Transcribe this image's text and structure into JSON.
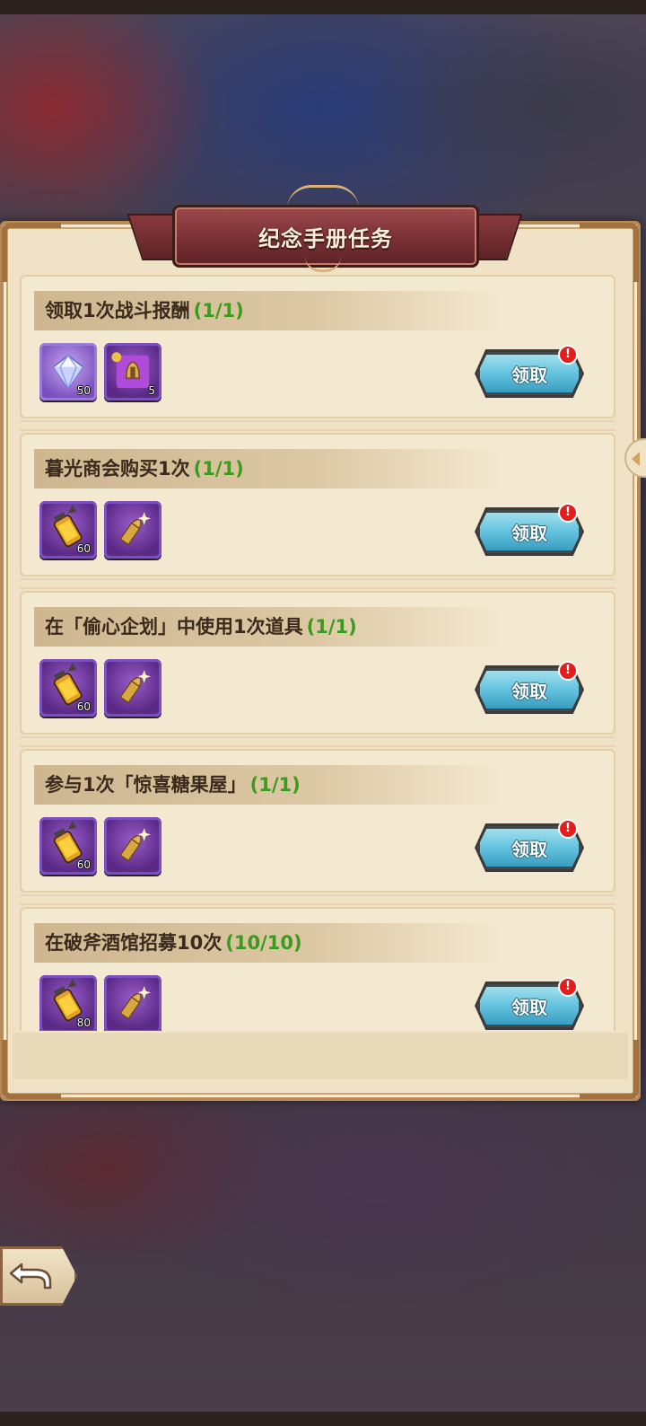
{
  "panel": {
    "title": "纪念手册任务"
  },
  "tasks": [
    {
      "title": "领取1次战斗报酬",
      "progress": "(1/1)",
      "rewards": [
        {
          "icon": "diamond-icon",
          "count": "50"
        },
        {
          "icon": "puzzle-helmet-icon",
          "count": "5"
        }
      ],
      "claim_label": "领取",
      "badge": "!"
    },
    {
      "title": "暮光商会购买1次",
      "progress": "(1/1)",
      "rewards": [
        {
          "icon": "fuel-canister-icon",
          "count": "60"
        },
        {
          "icon": "bullet-icon",
          "count": ""
        }
      ],
      "claim_label": "领取",
      "badge": "!"
    },
    {
      "title": "在「偷心企划」中使用1次道具",
      "progress": "(1/1)",
      "rewards": [
        {
          "icon": "fuel-canister-icon",
          "count": "60"
        },
        {
          "icon": "bullet-icon",
          "count": ""
        }
      ],
      "claim_label": "领取",
      "badge": "!"
    },
    {
      "title": "参与1次「惊喜糖果屋」",
      "progress": "(1/1)",
      "rewards": [
        {
          "icon": "fuel-canister-icon",
          "count": "60"
        },
        {
          "icon": "bullet-icon",
          "count": ""
        }
      ],
      "claim_label": "领取",
      "badge": "!"
    },
    {
      "title": "在破斧酒馆招募10次",
      "progress": "(10/10)",
      "rewards": [
        {
          "icon": "fuel-canister-icon",
          "count": "80"
        },
        {
          "icon": "bullet-icon",
          "count": ""
        }
      ],
      "claim_label": "领取",
      "badge": "!"
    }
  ],
  "colors": {
    "progress": "#3c9a1e",
    "claim_button": "#5ec0dc",
    "badge": "#e01e1e",
    "ribbon": "#7a3036",
    "panel": "#efe2c6"
  }
}
